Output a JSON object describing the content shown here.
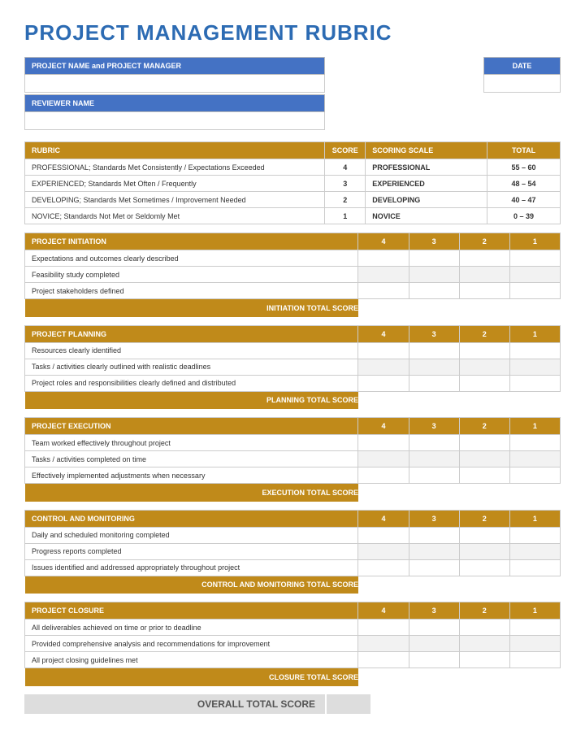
{
  "title": "PROJECT MANAGEMENT RUBRIC",
  "header": {
    "project_label": "PROJECT NAME and PROJECT MANAGER",
    "date_label": "DATE",
    "reviewer_label": "REVIEWER NAME",
    "project_value": "",
    "date_value": "",
    "reviewer_value": ""
  },
  "rubric": {
    "cols": {
      "rubric": "RUBRIC",
      "score": "SCORE",
      "scale": "SCORING SCALE",
      "total": "TOTAL"
    },
    "rows": [
      {
        "desc": "PROFESSIONAL; Standards Met Consistently / Expectations Exceeded",
        "score": "4",
        "scale": "PROFESSIONAL",
        "total": "55 – 60"
      },
      {
        "desc": "EXPERIENCED; Standards Met Often / Frequently",
        "score": "3",
        "scale": "EXPERIENCED",
        "total": "48 – 54"
      },
      {
        "desc": "DEVELOPING; Standards Met Sometimes / Improvement Needed",
        "score": "2",
        "scale": "DEVELOPING",
        "total": "40 – 47"
      },
      {
        "desc": "NOVICE; Standards Not Met or Seldomly Met",
        "score": "1",
        "scale": "NOVICE",
        "total": "0 – 39"
      }
    ]
  },
  "score_cols": [
    "4",
    "3",
    "2",
    "1"
  ],
  "sections": [
    {
      "name": "PROJECT INITIATION",
      "criteria": [
        "Expectations and outcomes clearly described",
        "Feasibility study completed",
        "Project stakeholders defined"
      ],
      "total_label": "INITIATION TOTAL SCORE"
    },
    {
      "name": "PROJECT PLANNING",
      "criteria": [
        "Resources clearly identified",
        "Tasks / activities clearly outlined with realistic deadlines",
        "Project roles and responsibilities clearly defined and distributed"
      ],
      "total_label": "PLANNING TOTAL SCORE"
    },
    {
      "name": "PROJECT EXECUTION",
      "criteria": [
        "Team worked effectively throughout project",
        "Tasks / activities completed on time",
        "Effectively implemented adjustments when necessary"
      ],
      "total_label": "EXECUTION TOTAL SCORE"
    },
    {
      "name": "CONTROL AND MONITORING",
      "criteria": [
        "Daily and scheduled monitoring completed",
        "Progress reports completed",
        "Issues identified and addressed appropriately throughout project"
      ],
      "total_label": "CONTROL AND MONITORING TOTAL SCORE"
    },
    {
      "name": "PROJECT CLOSURE",
      "criteria": [
        "All deliverables achieved on time or prior to deadline",
        "Provided comprehensive analysis and recommendations for improvement",
        "All project closing guidelines met"
      ],
      "total_label": "CLOSURE TOTAL SCORE"
    }
  ],
  "overall_label": "OVERALL TOTAL SCORE"
}
